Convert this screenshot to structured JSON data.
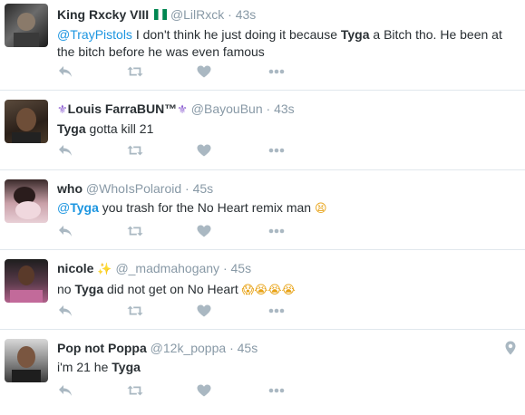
{
  "tweets": [
    {
      "name": "King Rxcky VIII",
      "handle": "@LilRxck",
      "sep": "·",
      "time": "43s",
      "text": {
        "mention": "@TrayPistols",
        "p1": " I don't think he just doing it because ",
        "kw": "Tyga",
        "p2": " a Bitch tho. He been at the bitch before he was even famous"
      },
      "flag_icon": "nigeria-flag-icon"
    },
    {
      "name_lead_emoji": "⚜",
      "name": "Louis FarraBUN™",
      "name_trail_emoji": "⚜",
      "handle": "@BayouBun",
      "sep": "·",
      "time": "43s",
      "text": {
        "kw": "Tyga",
        "p1": " gotta kill 21"
      }
    },
    {
      "name": "who",
      "handle": "@WhoIsPolaroid",
      "sep": "·",
      "time": "45s",
      "text": {
        "mention_at": "@",
        "mention_kw": "Tyga",
        "p1": " you trash for the No Heart remix man ",
        "emoji": "😫"
      }
    },
    {
      "name": "nicole",
      "name_emoji": "✨",
      "handle": "@_madmahogany",
      "sep": "·",
      "time": "45s",
      "text": {
        "p0": "no ",
        "kw": "Tyga",
        "p1": " did not get on No Heart ",
        "emoji": "😱😭😭😭"
      }
    },
    {
      "name": "Pop not Poppa",
      "handle": "@12k_poppa",
      "sep": "·",
      "time": "45s",
      "text": {
        "p0": "i'm 21 he ",
        "kw": "Tyga"
      },
      "location_icon": "location-pin-icon"
    }
  ],
  "action_icons": [
    "reply-icon",
    "retweet-icon",
    "like-icon",
    "more-icon"
  ],
  "colors": {
    "icon": "#aab8c2",
    "link": "#1b95e0",
    "meta": "#8899a6",
    "border": "#e1e8ed"
  }
}
